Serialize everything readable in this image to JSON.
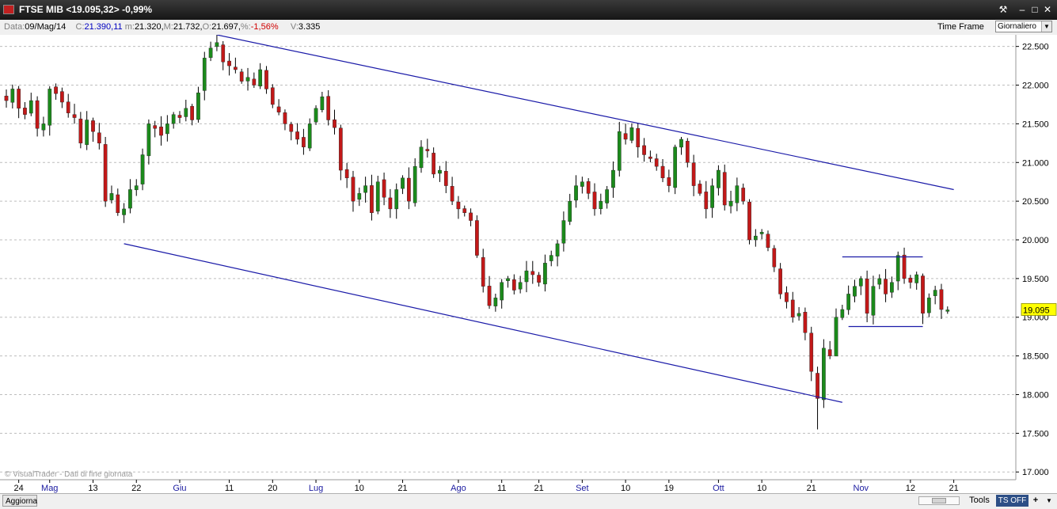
{
  "window": {
    "title": "FTSE MIB <19.095,32> -0,99%",
    "controls": {
      "tools": "⚒",
      "minimize": "–",
      "maximize": "□",
      "close": "✕"
    }
  },
  "info_bar": {
    "date_label": "Data:",
    "date_value": "09/Mag/14",
    "close_label": "C:",
    "close_value": "21.390,11",
    "low_label": "m:",
    "low_value": "21.320,",
    "high_label": "M:",
    "high_value": "21.732,",
    "open_label": "O:",
    "open_value": "21.697,",
    "pct_label": "%:",
    "pct_value": "-1,56%",
    "volume_label": "V:",
    "volume_value": "3.335",
    "timeframe_label": "Time Frame",
    "timeframe_value": "Giornaliero"
  },
  "bottom_bar": {
    "refresh_label": "Aggiorna",
    "tools_label": "Tools",
    "ts_label": "TS OFF",
    "plus_label": "+"
  },
  "colors": {
    "up": "#1b8a1b",
    "down": "#c21818",
    "wick": "#000000",
    "trendline": "#1a1aa8",
    "price_tag": "#ffff00"
  },
  "chart_data": {
    "type": "candlestick",
    "instrument": "FTSE MIB",
    "last_price_label": "19.095",
    "last_price": 19095,
    "watermark": "© VisualTrader - Dati di fine giornata",
    "ylim": [
      16900,
      22650
    ],
    "yticks": [
      {
        "value": 22500,
        "label": "22.500"
      },
      {
        "value": 22000,
        "label": "22.000"
      },
      {
        "value": 21500,
        "label": "21.500"
      },
      {
        "value": 21000,
        "label": "21.000"
      },
      {
        "value": 20500,
        "label": "20.500"
      },
      {
        "value": 20000,
        "label": "20.000"
      },
      {
        "value": 19500,
        "label": "19.500"
      },
      {
        "value": 19000,
        "label": "19.000"
      },
      {
        "value": 18500,
        "label": "18.500"
      },
      {
        "value": 18000,
        "label": "18.000"
      },
      {
        "value": 17500,
        "label": "17.500"
      },
      {
        "value": 17000,
        "label": "17.000"
      }
    ],
    "xlim": [
      0,
      162
    ],
    "xticks": [
      {
        "index": 2,
        "label": "24",
        "month": false
      },
      {
        "index": 7,
        "label": "Mag",
        "month": true
      },
      {
        "index": 14,
        "label": "13",
        "month": false
      },
      {
        "index": 21,
        "label": "22",
        "month": false
      },
      {
        "index": 28,
        "label": "Giu",
        "month": true
      },
      {
        "index": 36,
        "label": "11",
        "month": false
      },
      {
        "index": 43,
        "label": "20",
        "month": false
      },
      {
        "index": 50,
        "label": "Lug",
        "month": true
      },
      {
        "index": 57,
        "label": "10",
        "month": false
      },
      {
        "index": 64,
        "label": "21",
        "month": false
      },
      {
        "index": 73,
        "label": "Ago",
        "month": true
      },
      {
        "index": 80,
        "label": "11",
        "month": false
      },
      {
        "index": 86,
        "label": "21",
        "month": false
      },
      {
        "index": 93,
        "label": "Set",
        "month": true
      },
      {
        "index": 100,
        "label": "10",
        "month": false
      },
      {
        "index": 107,
        "label": "19",
        "month": false
      },
      {
        "index": 115,
        "label": "Ott",
        "month": true
      },
      {
        "index": 122,
        "label": "10",
        "month": false
      },
      {
        "index": 130,
        "label": "21",
        "month": false
      },
      {
        "index": 138,
        "label": "Nov",
        "month": true
      },
      {
        "index": 146,
        "label": "12",
        "month": false
      },
      {
        "index": 153,
        "label": "21",
        "month": false
      }
    ],
    "closes": [
      21800,
      21950,
      21700,
      21620,
      21800,
      21440,
      21500,
      21950,
      21890,
      21780,
      21640,
      21580,
      21250,
      21550,
      21400,
      21250,
      20500,
      20600,
      20350,
      20400,
      20650,
      20700,
      21100,
      21500,
      21440,
      21350,
      21500,
      21620,
      21580,
      21700,
      21550,
      21900,
      22350,
      22480,
      22550,
      22300,
      22250,
      22200,
      22050,
      22100,
      22000,
      22200,
      21950,
      21750,
      21650,
      21500,
      21400,
      21300,
      21200,
      21500,
      21700,
      21850,
      21550,
      21450,
      20900,
      20800,
      20500,
      20600,
      20700,
      20350,
      20750,
      20550,
      20400,
      20650,
      20800,
      20500,
      20950,
      21200,
      21150,
      20850,
      20900,
      20700,
      20500,
      20400,
      20350,
      20250,
      19800,
      19400,
      19150,
      19250,
      19450,
      19500,
      19350,
      19450,
      19600,
      19550,
      19450,
      19700,
      19800,
      19950,
      20250,
      20500,
      20700,
      20750,
      20600,
      20400,
      20500,
      20650,
      20900,
      21400,
      21300,
      21450,
      21200,
      21100,
      21050,
      20950,
      20800,
      20700,
      21200,
      21300,
      21000,
      20700,
      20600,
      20400,
      20700,
      20900,
      20450,
      20500,
      20700,
      20500,
      20000,
      20050,
      20100,
      19900,
      19650,
      19300,
      19200,
      19000,
      19050,
      18800,
      18300,
      17950,
      18600,
      18500,
      19000,
      19100,
      19300,
      19400,
      19500,
      19050,
      19400,
      19500,
      19300,
      19450,
      19800,
      19500,
      19450,
      19550,
      19050,
      19250,
      19350,
      19100,
      19095
    ],
    "trendlines": [
      {
        "from": {
          "x": 34,
          "y": 22650
        },
        "to": {
          "x": 153,
          "y": 20650
        }
      },
      {
        "from": {
          "x": 19,
          "y": 19950
        },
        "to": {
          "x": 135,
          "y": 17900
        }
      },
      {
        "from": {
          "x": 135,
          "y": 19780
        },
        "to": {
          "x": 148,
          "y": 19780
        }
      },
      {
        "from": {
          "x": 136,
          "y": 18880
        },
        "to": {
          "x": 148,
          "y": 18880
        }
      }
    ]
  }
}
